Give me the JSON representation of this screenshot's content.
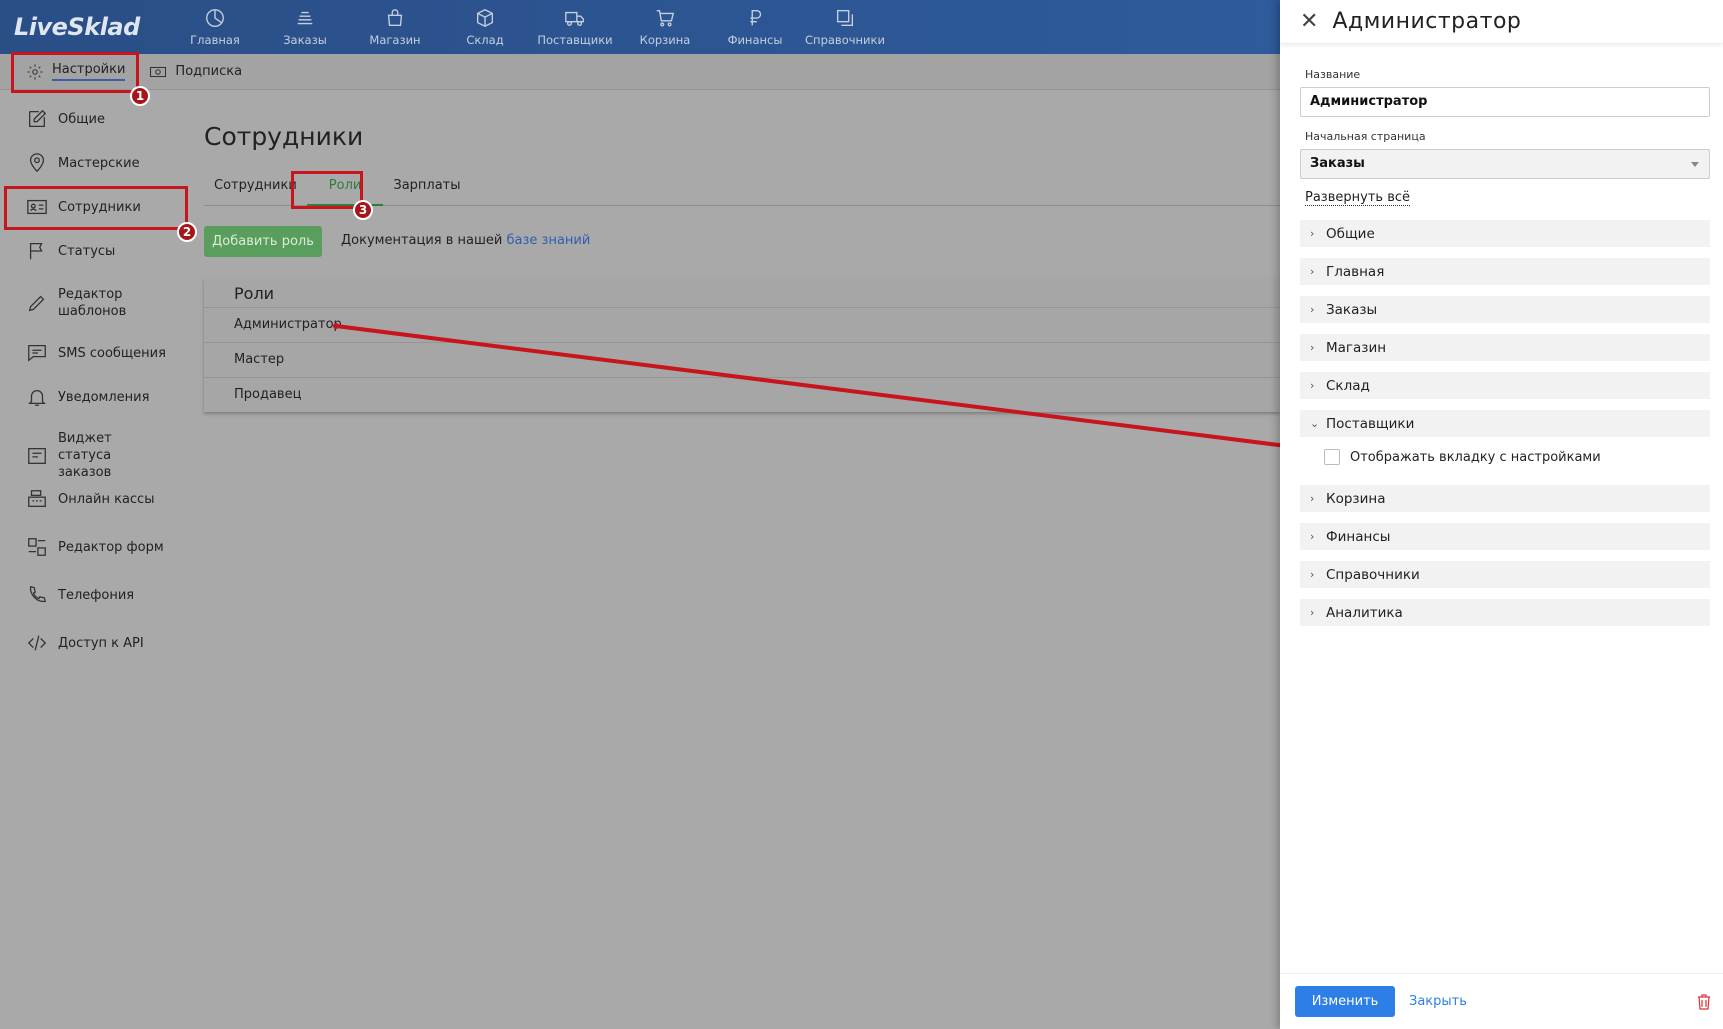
{
  "app": {
    "logo": "LiveSklad"
  },
  "nav": [
    {
      "label": "Главная",
      "icon": "pie-chart-icon"
    },
    {
      "label": "Заказы",
      "icon": "money-icon"
    },
    {
      "label": "Магазин",
      "icon": "bag-icon"
    },
    {
      "label": "Склад",
      "icon": "box-icon"
    },
    {
      "label": "Поставщики",
      "icon": "truck-icon"
    },
    {
      "label": "Корзина",
      "icon": "cart-icon"
    },
    {
      "label": "Финансы",
      "icon": "ruble-icon"
    },
    {
      "label": "Справочники",
      "icon": "books-icon"
    }
  ],
  "subbar": {
    "settings": "Настройки",
    "subscription": "Подписка"
  },
  "sidebar": [
    {
      "label": "Общие",
      "icon": "edit-icon"
    },
    {
      "label": "Мастерские",
      "icon": "location-icon"
    },
    {
      "label": "Сотрудники",
      "icon": "id-card-icon"
    },
    {
      "label": "Статусы",
      "icon": "flag-icon"
    },
    {
      "label": "Редактор шаблонов",
      "icon": "pencil-icon"
    },
    {
      "label": "SMS сообщения",
      "icon": "chat-icon"
    },
    {
      "label": "Уведомления",
      "icon": "bell-icon"
    },
    {
      "label": "Виджет статуса заказов",
      "icon": "widget-icon"
    },
    {
      "label": "Онлайн кассы",
      "icon": "cash-register-icon"
    },
    {
      "label": "Редактор форм",
      "icon": "form-icon"
    },
    {
      "label": "Телефония",
      "icon": "phone-icon"
    },
    {
      "label": "Доступ к API",
      "icon": "code-icon"
    }
  ],
  "main": {
    "title": "Сотрудники",
    "tabs": [
      "Сотрудники",
      "Роли",
      "Зарплаты"
    ],
    "add_role": "Добавить роль",
    "doc_text": "Документация в нашей",
    "doc_link": "базе знаний",
    "roles_header": "Роли",
    "roles": [
      "Администратор",
      "Мастер",
      "Продавец"
    ]
  },
  "annotations": {
    "badge1": "1",
    "badge2": "2",
    "badge3": "3",
    "color": "#c8141d"
  },
  "panel": {
    "title": "Администратор",
    "name_label": "Название",
    "name_value": "Администратор",
    "start_label": "Начальная страница",
    "start_value": "Заказы",
    "expand_all": "Развернуть всё",
    "sections": [
      "Общие",
      "Главная",
      "Заказы",
      "Магазин",
      "Склад",
      "Поставщики",
      "Корзина",
      "Финансы",
      "Справочники",
      "Аналитика"
    ],
    "expanded_section": "Поставщики",
    "checkbox_label": "Отображать вкладку с настройками",
    "checkbox_checked": false,
    "save": "Изменить",
    "close": "Закрыть"
  }
}
